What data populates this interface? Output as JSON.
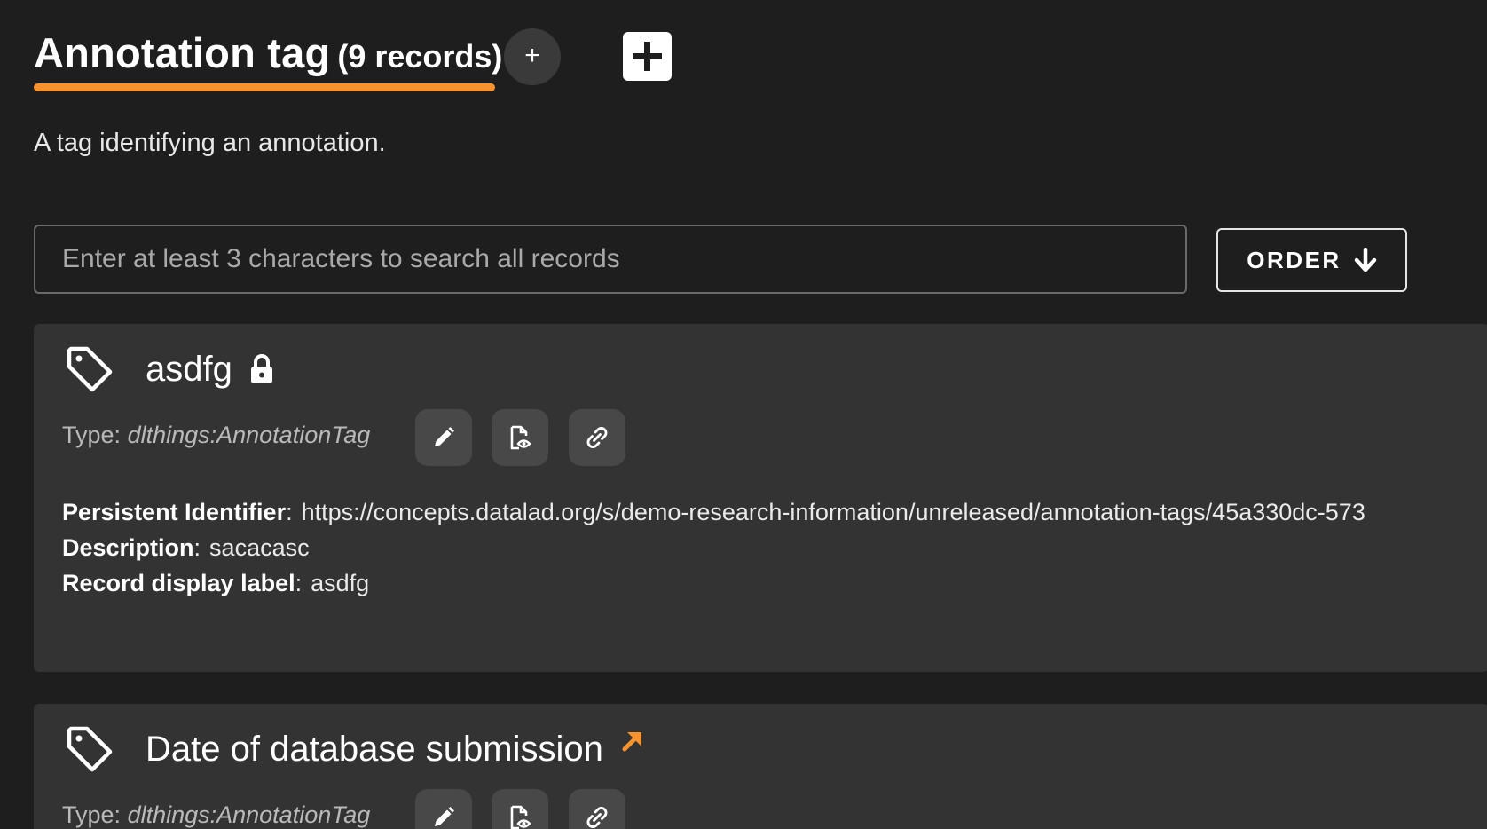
{
  "header": {
    "title": "Annotation tag",
    "count": "(9 records)",
    "add_circle_label": "+",
    "description": "A tag identifying an annotation."
  },
  "search": {
    "placeholder": "Enter at least 3 characters to search all records"
  },
  "order": {
    "label": "ORDER"
  },
  "colors": {
    "accent": "#f7932e",
    "background": "#1e1e1e",
    "card": "#333333"
  },
  "records": [
    {
      "title": "asdfg",
      "type_label": "Type:",
      "type_value": "dlthings:AnnotationTag",
      "props": [
        {
          "key": "Persistent Identifier",
          "value": "https://concepts.datalad.org/s/demo-research-information/unreleased/annotation-tags/45a330dc-573"
        },
        {
          "key": "Description",
          "value": "sacacasc"
        },
        {
          "key": "Record display label",
          "value": "asdfg"
        }
      ]
    },
    {
      "title": "Date of database submission",
      "type_label": "Type:",
      "type_value": "dlthings:AnnotationTag"
    }
  ]
}
